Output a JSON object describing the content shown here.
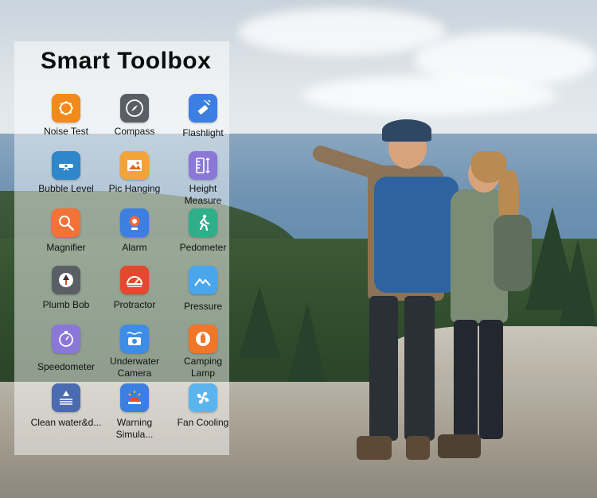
{
  "title": "Smart Toolbox",
  "colors": {
    "orange": "#f28a1b",
    "dark_gray": "#5a5f66",
    "blue": "#3d7fe0",
    "violet": "#8a78d8",
    "green": "#2fae8a",
    "red": "#e5472f",
    "sky_blue": "#4aa6ec"
  },
  "tools": [
    {
      "label": "Noise Test",
      "icon": "noise-test-icon"
    },
    {
      "label": "Compass",
      "icon": "compass-icon"
    },
    {
      "label": "Flashlight",
      "icon": "flashlight-icon"
    },
    {
      "label": "Bubble Level",
      "icon": "bubble-level-icon"
    },
    {
      "label": "Pic Hanging",
      "icon": "picture-hanging-icon"
    },
    {
      "label": "Height Measure",
      "label_line1": "Height",
      "label_line2": "Measure",
      "icon": "ruler-icon"
    },
    {
      "label": "Magnifier",
      "icon": "magnifier-icon"
    },
    {
      "label": "Alarm",
      "icon": "alarm-icon"
    },
    {
      "label": "Pedometer",
      "icon": "pedometer-icon"
    },
    {
      "label": "Plumb Bob",
      "icon": "plumb-bob-icon"
    },
    {
      "label": "Protractor",
      "icon": "protractor-icon"
    },
    {
      "label": "Pressure",
      "icon": "pressure-icon"
    },
    {
      "label": "Speedometer",
      "icon": "speedometer-icon"
    },
    {
      "label": "Underwater Camera",
      "label_line1": "Underwater",
      "label_line2": "Camera",
      "icon": "underwater-camera-icon"
    },
    {
      "label": "Camping Lamp",
      "label_line1": "Camping",
      "label_line2": "Lamp",
      "icon": "camping-lamp-icon"
    },
    {
      "label": "Clean water&d...",
      "icon": "clean-water-icon"
    },
    {
      "label": "Warning Simula...",
      "label_line1": "Warning",
      "label_line2": "Simula...",
      "icon": "warning-light-icon"
    },
    {
      "label": "Fan Cooling",
      "icon": "fan-icon"
    }
  ]
}
